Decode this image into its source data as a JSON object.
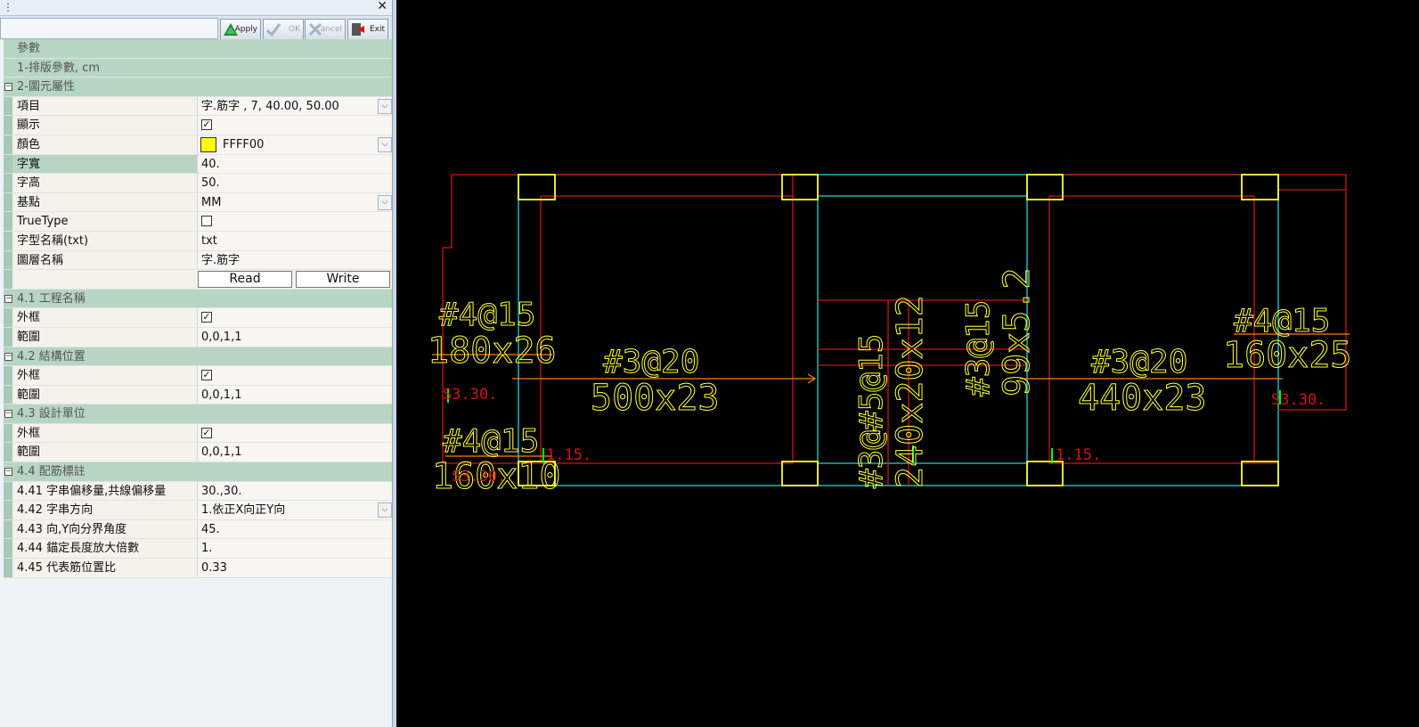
{
  "window": {
    "pin_glyph": "⋮",
    "close_glyph": "✕"
  },
  "toolbar": {
    "apply": "Apply",
    "ok": "OK",
    "cancel": "Cancel",
    "exit": "Exit"
  },
  "grid": {
    "header": "參數",
    "sec1": "1-排版參數, cm",
    "sec2": "2-圖元屬性",
    "item_label": "項目",
    "item_value": "字.筋字 , 7, 40.00, 50.00",
    "show_label": "顯示",
    "color_label": "顏色",
    "color_value": "FFFF00",
    "width_label": "字寬",
    "width_value": "40.",
    "height_label": "字高",
    "height_value": "50.",
    "base_label": "基點",
    "base_value": "MM",
    "truetype_label": "TrueType",
    "font_label": "字型名稱(txt)",
    "font_value": "txt",
    "layer_label": "圖層名稱",
    "layer_value": "字.筋字",
    "read": "Read",
    "write": "Write",
    "sec41": "4.1 工程名稱",
    "frame_label": "外框",
    "range_label": "範圍",
    "range_value": "0,0,1,1",
    "sec42": "4.2 結構位置",
    "sec43": "4.3 設計單位",
    "sec44": "4.4 配筋標註",
    "p441_label": "4.41 字串偏移量,共線偏移量",
    "p441_value": "30.,30.",
    "p442_label": "4.42 字串方向",
    "p442_value": "1.依正X向正Y向",
    "p443_label": "4.43 向,Y向分界角度",
    "p443_value": "45.",
    "p444_label": "4.44 錨定長度放大倍數",
    "p444_value": "1.",
    "p445_label": "4.45 代表筋位置比",
    "p445_value": "0.33",
    "check": "✓",
    "expand": "−",
    "dropdown": "⌵"
  },
  "drawing": {
    "labels": {
      "t1a": "#4@15",
      "t1b": "180x26",
      "t2a": "#3@20",
      "t2b": "500x23",
      "t3a": "#4@15",
      "t3b": "160x10",
      "t4a": "#3@20",
      "t4b": "440x23",
      "t5a": "#4@15",
      "t5b": "160x25",
      "v1": "#3@#5@15",
      "v2": "240x20x12",
      "v3": "#3@15",
      "v4": "99x5.2",
      "r1": "S3.30.",
      "r2": "1.15.",
      "r3": "1.15.",
      "r4": "S3.30.",
      "r5": "S3.30."
    },
    "colors": {
      "yellow": "#ffff33",
      "red": "#d11313",
      "cyan": "#22d3d3",
      "orange": "#ff8000",
      "green": "#00ff00"
    }
  }
}
